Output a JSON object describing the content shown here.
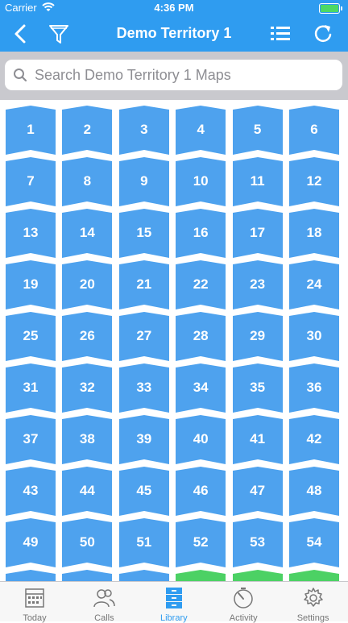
{
  "status": {
    "carrier": "Carrier",
    "time": "4:36 PM"
  },
  "nav": {
    "title": "Demo Territory 1"
  },
  "search": {
    "placeholder": "Search Demo Territory 1 Maps"
  },
  "grid": {
    "columns": 6,
    "tile_color": "#4ea2ee",
    "partial_tile_colors": [
      "#4ea2ee",
      "#4ea2ee",
      "#4ea2ee",
      "#4cd164",
      "#4cd164",
      "#4cd164"
    ],
    "tiles": [
      "1",
      "2",
      "3",
      "4",
      "5",
      "6",
      "7",
      "8",
      "9",
      "10",
      "11",
      "12",
      "13",
      "14",
      "15",
      "16",
      "17",
      "18",
      "19",
      "20",
      "21",
      "22",
      "23",
      "24",
      "25",
      "26",
      "27",
      "28",
      "29",
      "30",
      "31",
      "32",
      "33",
      "34",
      "35",
      "36",
      "37",
      "38",
      "39",
      "40",
      "41",
      "42",
      "43",
      "44",
      "45",
      "46",
      "47",
      "48",
      "49",
      "50",
      "51",
      "52",
      "53",
      "54"
    ]
  },
  "tabs": [
    {
      "label": "Today",
      "icon": "calendar-icon"
    },
    {
      "label": "Calls",
      "icon": "people-icon"
    },
    {
      "label": "Library",
      "icon": "drawer-icon",
      "active": true
    },
    {
      "label": "Activity",
      "icon": "gauge-icon"
    },
    {
      "label": "Settings",
      "icon": "gear-icon"
    }
  ]
}
